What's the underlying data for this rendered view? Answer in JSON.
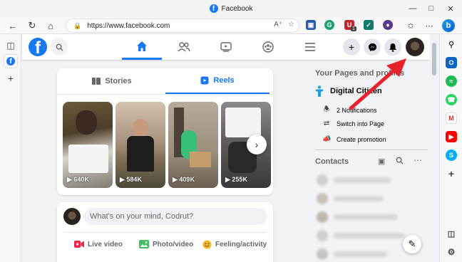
{
  "window": {
    "title": "Facebook",
    "controls": [
      "minimize",
      "maximize",
      "close"
    ]
  },
  "browser": {
    "url": "https://www.facebook.com",
    "nav": [
      "back",
      "refresh",
      "home"
    ],
    "url_icons": [
      "read-aloud-icon",
      "add-favorite-icon"
    ],
    "extension_badge": "1",
    "left_strip": [
      "tab-actions-icon",
      "facebook-tab",
      "new-tab-plus"
    ],
    "right_sidebar": [
      "bing-icon",
      "search-icon",
      "outlook-icon",
      "spotify-icon",
      "whatsapp-icon",
      "gmail-icon",
      "youtube-icon",
      "skype-icon",
      "add-icon",
      "split-screen-icon",
      "settings-icon"
    ]
  },
  "fb_header": {
    "logo": "f",
    "tabs": [
      "home",
      "friends",
      "watch",
      "groups",
      "menu"
    ],
    "actions": [
      "create-icon",
      "messenger-icon",
      "notifications-icon",
      "account-avatar"
    ]
  },
  "stories": {
    "tabs": [
      {
        "label": "Stories",
        "active": false
      },
      {
        "label": "Reels",
        "active": true
      }
    ],
    "reels": [
      {
        "count": "640K"
      },
      {
        "count": "584K"
      },
      {
        "count": "409K"
      },
      {
        "count": "255K"
      }
    ]
  },
  "composer": {
    "placeholder": "What's on your mind, Codrut?",
    "actions": [
      {
        "label": "Live video",
        "color": "#f02849"
      },
      {
        "label": "Photo/video",
        "color": "#45bd62"
      },
      {
        "label": "Feeling/activity",
        "color": "#f7b928"
      }
    ]
  },
  "right_column": {
    "pages_title": "Your Pages and profiles",
    "page_name": "Digital Citizen",
    "page_items": [
      {
        "icon": "bell-icon",
        "label": "2 Notifications"
      },
      {
        "icon": "switch-icon",
        "label": "Switch into Page"
      },
      {
        "icon": "megaphone-icon",
        "label": "Create promotion"
      }
    ],
    "contacts_title": "Contacts"
  },
  "colors": {
    "fb_blue": "#1877f2",
    "bg": "#f0f2f5",
    "arrow_red": "#e8212b"
  }
}
